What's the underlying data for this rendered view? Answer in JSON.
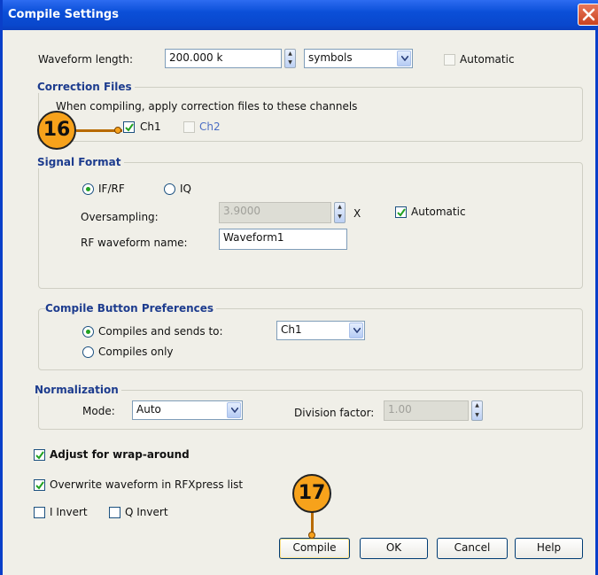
{
  "window": {
    "title": "Compile Settings"
  },
  "waveform_length": {
    "label": "Waveform length:",
    "value": "200.000 k",
    "unit": "symbols",
    "automatic_label": "Automatic",
    "automatic_checked": false
  },
  "correction_files": {
    "title": "Correction Files",
    "description": "When compiling, apply correction files to these channels",
    "ch1_label": "Ch1",
    "ch1_checked": true,
    "ch2_label": "Ch2",
    "ch2_checked": false
  },
  "signal_format": {
    "title": "Signal Format",
    "ifrf_label": "IF/RF",
    "ifrf_selected": true,
    "iq_label": "IQ",
    "iq_selected": false,
    "oversampling_label": "Oversampling:",
    "oversampling_value": "3.9000",
    "oversampling_unit": "X",
    "oversampling_auto_label": "Automatic",
    "oversampling_auto_checked": true,
    "rf_name_label": "RF waveform name:",
    "rf_name_value": "Waveform1"
  },
  "compile_prefs": {
    "title": "Compile Button Preferences",
    "option1_label": "Compiles and sends to:",
    "option1_selected": true,
    "channel_value": "Ch1",
    "option2_label": "Compiles only",
    "option2_selected": false
  },
  "normalization": {
    "title": "Normalization",
    "mode_label": "Mode:",
    "mode_value": "Auto",
    "division_label": "Division factor:",
    "division_value": "1.00"
  },
  "options": {
    "wrap_label": "Adjust for wrap-around",
    "wrap_checked": true,
    "overwrite_label": "Overwrite waveform in RFXpress list",
    "overwrite_checked": true,
    "i_invert_label": "I Invert",
    "i_invert_checked": false,
    "q_invert_label": "Q Invert",
    "q_invert_checked": false
  },
  "buttons": {
    "compile": "Compile",
    "ok": "OK",
    "cancel": "Cancel",
    "help": "Help"
  },
  "callouts": {
    "step16": "16",
    "step17": "17"
  },
  "colors": {
    "titlebar": "#0b4fd8",
    "group_title": "#1d3c8e",
    "callout": "#f7a21b",
    "check": "#21a121"
  }
}
